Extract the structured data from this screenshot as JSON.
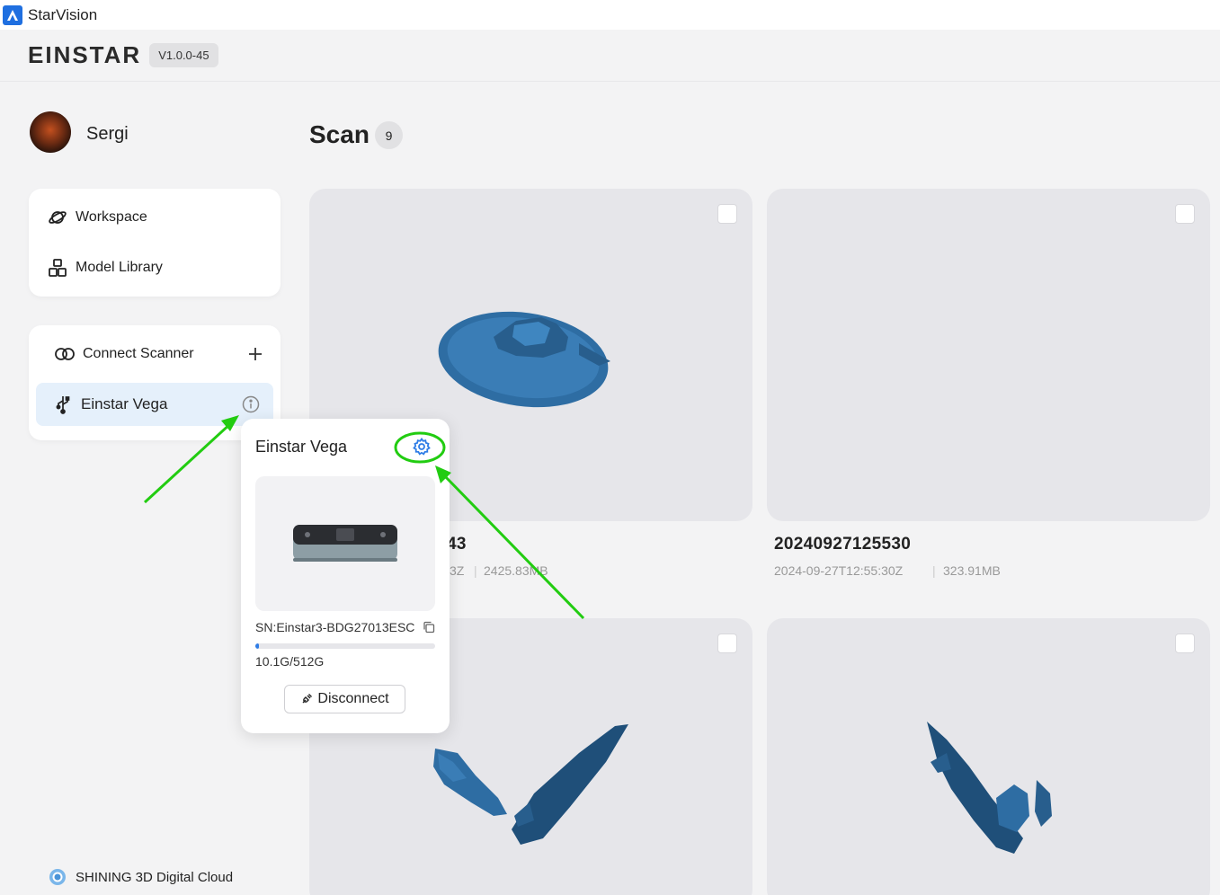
{
  "window": {
    "app_name": "StarVision"
  },
  "header": {
    "logo": "EINSTAR",
    "version": "V1.0.0-45"
  },
  "user": {
    "name": "Sergi"
  },
  "nav": {
    "items": [
      {
        "label": "Workspace",
        "icon": "planet-icon"
      },
      {
        "label": "Model Library",
        "icon": "cubes-icon"
      }
    ]
  },
  "scanner": {
    "connect_label": "Connect Scanner",
    "device_name": "Einstar Vega"
  },
  "cloud": {
    "label": "SHINING 3D Digital Cloud"
  },
  "main": {
    "title": "Scan",
    "count": "9",
    "cards": [
      {
        "title": "43",
        "date": "3Z",
        "size": "2425.83MB"
      },
      {
        "title": "20240927125530",
        "date": "2024-09-27T12:55:30Z",
        "size": "323.91MB"
      },
      {
        "title": "",
        "date": "",
        "size": ""
      },
      {
        "title": "",
        "date": "",
        "size": ""
      }
    ]
  },
  "popup": {
    "title": "Einstar Vega",
    "serial": "SN:Einstar3-BDG27013ESC",
    "storage": "10.1G/512G",
    "storage_fraction": 0.02,
    "disconnect_label": "Disconnect"
  },
  "colors": {
    "accent": "#2f7de6",
    "annotation": "#22cc11",
    "model_blue": "#2e6da3"
  }
}
